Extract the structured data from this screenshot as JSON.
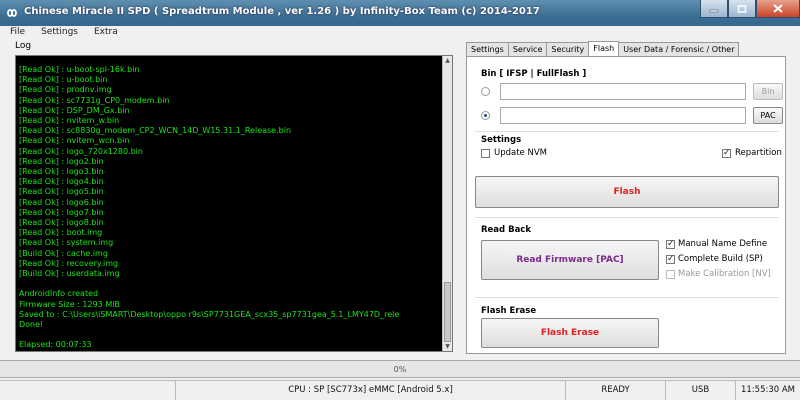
{
  "window": {
    "title": "Chinese Miracle II SPD ( Spreadtrum Module , ver 1.26 ) by Infinity-Box Team (c) 2014-2017"
  },
  "menu": [
    "File",
    "Settings",
    "Extra"
  ],
  "log": {
    "label": "Log",
    "lines": [
      "[Read Ok] : u-boot-spl-16k.bin",
      "[Read Ok] : u-boot.bin",
      "[Read Ok] : prodnv.img",
      "[Read Ok] : sc7731g_CP0_modem.bin",
      "[Read Ok] : DSP_DM_Gx.bin",
      "[Read Ok] : nvitem_w.bin",
      "[Read Ok] : sc8830g_modem_CP2_WCN_14D_W15.31.1_Release.bin",
      "[Read Ok] : nvitem_wcn.bin",
      "[Read Ok] : logo_720x1280.bin",
      "[Read Ok] : logo2.bin",
      "[Read Ok] : logo3.bin",
      "[Read Ok] : logo4.bin",
      "[Read Ok] : logo5.bin",
      "[Read Ok] : logo6.bin",
      "[Read Ok] : logo7.bin",
      "[Read Ok] : logo8.bin",
      "[Read Ok] : boot.img",
      "[Read Ok] : system.img",
      "[Build Ok] : cache.img",
      "[Read Ok] : recovery.img",
      "[Build Ok] : userdata.img",
      "",
      "AndroidInfo created",
      "Firmware Size : 1293 MiB",
      "Saved to : C:\\Users\\iSMART\\Desktop\\oppo r9s\\SP7731GEA_scx35_sp7731gea_5.1_LMY47D_rele",
      "Done!",
      "",
      "Elapsed: 00:07:33"
    ]
  },
  "tabs": [
    {
      "label": "Settings",
      "active": false
    },
    {
      "label": "Service",
      "active": false
    },
    {
      "label": "Security",
      "active": false
    },
    {
      "label": "Flash",
      "active": true
    },
    {
      "label": "User Data / Forensic / Other",
      "active": false
    }
  ],
  "flash": {
    "bin_section": "Bin  [ IFSP | FullFlash ]",
    "bin_value": "",
    "pac_value": "",
    "bin_button": "Bin",
    "pac_button": "PAC",
    "settings_title": "Settings",
    "update_nvm": {
      "label": "Update NVM",
      "checked": false
    },
    "repartition": {
      "label": "Repartition",
      "checked": true
    },
    "flash_button": "Flash",
    "readback_title": "Read Back",
    "read_firmware_button": "Read Firmware [PAC]",
    "manual_name": {
      "label": "Manual Name Define",
      "checked": true
    },
    "complete_build": {
      "label": "Complete Build (SP)",
      "checked": true
    },
    "make_calibration": {
      "label": "Make Calibration [NV]",
      "checked": false
    },
    "erase_title": "Flash Erase",
    "erase_button": "Flash Erase"
  },
  "progress": {
    "text": "0%",
    "value": 0
  },
  "status": {
    "cpu": "CPU : SP [SC773x] eMMC [Android 5.x]",
    "state": "READY",
    "port": "USB",
    "time": "11:55:30 AM"
  },
  "colors": {
    "log_text": "#19e619",
    "flash_red": "#e02020",
    "read_purple": "#7a2a8a"
  }
}
